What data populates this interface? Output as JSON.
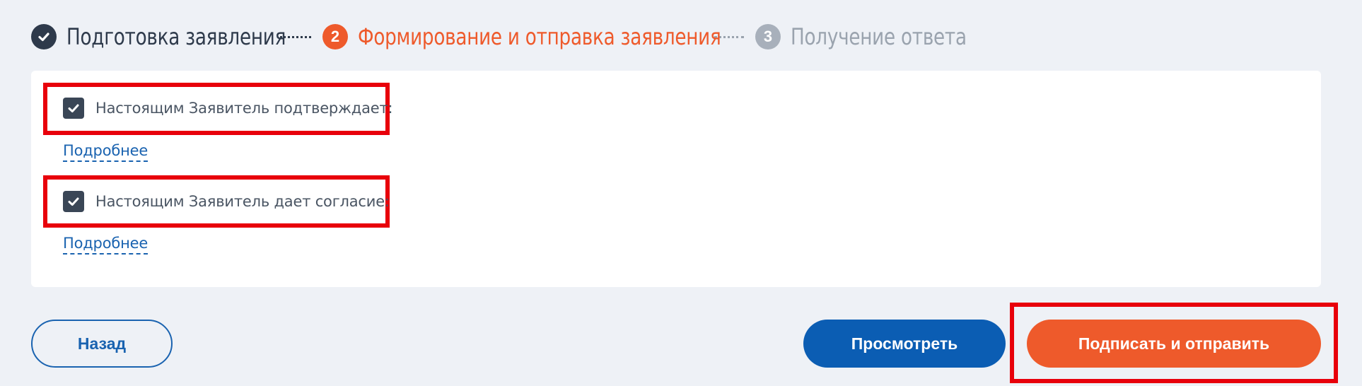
{
  "stepper": {
    "steps": [
      {
        "number": "",
        "label": "Подготовка заявления",
        "state": "done"
      },
      {
        "number": "2",
        "label": "Формирование и отправка заявления",
        "state": "active"
      },
      {
        "number": "3",
        "label": "Получение ответа",
        "state": "pending"
      }
    ]
  },
  "consents": [
    {
      "label": "Настоящим Заявитель подтверждает:",
      "checked": true,
      "more": "Подробнее"
    },
    {
      "label": "Настоящим Заявитель дает согласие:",
      "checked": true,
      "more": "Подробнее"
    }
  ],
  "actions": {
    "back_label": "Назад",
    "view_label": "Просмотреть",
    "sign_label": "Подписать и отправить"
  },
  "colors": {
    "accent_orange": "#ee5a2b",
    "primary_blue": "#0b5db3",
    "highlight_red": "#e8000b",
    "dark": "#2e3a4b"
  }
}
